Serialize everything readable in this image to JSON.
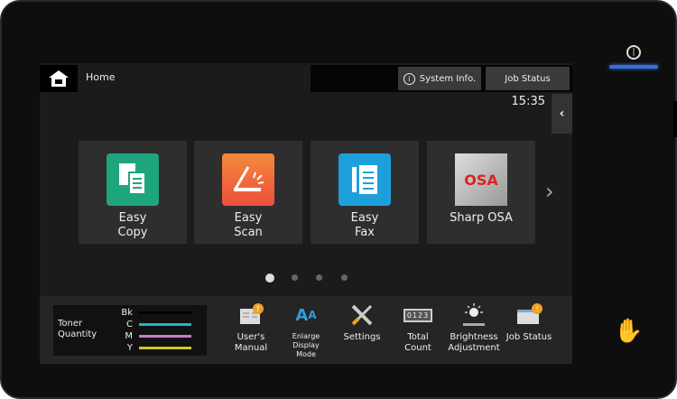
{
  "header": {
    "title": "Home",
    "system_info": "System Info.",
    "job_status": "Job Status",
    "time": "15:35"
  },
  "tiles": [
    {
      "label1": "Easy",
      "label2": "Copy",
      "icon": "copy-icon",
      "color": "#1fa57e"
    },
    {
      "label1": "Easy",
      "label2": "Scan",
      "icon": "scan-icon",
      "color": "#f05a3c"
    },
    {
      "label1": "Easy",
      "label2": "Fax",
      "icon": "fax-icon",
      "color": "#1e9fdc"
    },
    {
      "label1": "Sharp OSA",
      "label2": "",
      "icon": "osa-logo",
      "logo_text": "OSA"
    }
  ],
  "pagination": {
    "pages": 4,
    "current": 1
  },
  "toner": {
    "title1": "Toner",
    "title2": "Quantity",
    "levels": [
      {
        "label": "Bk",
        "color": "#000000"
      },
      {
        "label": "C",
        "color": "#1fb8c0"
      },
      {
        "label": "M",
        "color": "#c77cc8"
      },
      {
        "label": "Y",
        "color": "#c8cc1a"
      }
    ]
  },
  "shortcuts": [
    {
      "l1": "User's",
      "l2": "Manual",
      "icon": "manual-icon"
    },
    {
      "l1": "Enlarge",
      "l2": "Display",
      "l3": "Mode",
      "icon": "enlarge-text-icon"
    },
    {
      "l1": "Settings",
      "icon": "wrench-screwdriver-icon"
    },
    {
      "l1": "Total",
      "l2": "Count",
      "icon": "counter-icon",
      "counter": "0123"
    },
    {
      "l1": "Brightness",
      "l2": "Adjustment",
      "icon": "brightness-icon"
    },
    {
      "l1": "Job Status",
      "icon": "job-status-icon"
    }
  ]
}
